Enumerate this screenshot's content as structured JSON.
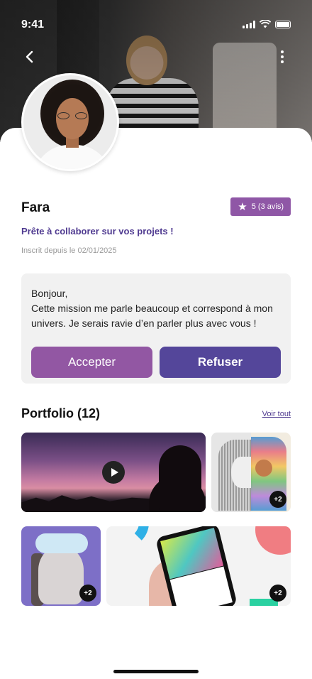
{
  "status_bar": {
    "time": "9:41"
  },
  "header": {
    "back_icon": "chevron-left-icon",
    "menu_icon": "more-vertical-icon"
  },
  "profile": {
    "name": "Fara",
    "rating": "5 (3 avis)",
    "tagline": "Prête à collaborer sur vos projets !",
    "joined": "Inscrit depuis le 02/01/2025"
  },
  "message": {
    "line1": "Bonjour,",
    "line2": "Cette mission me parle beaucoup et correspond à mon univers. Je serais ravie d’en parler plus avec vous !",
    "accept_label": "Accepter",
    "refuse_label": "Refuser"
  },
  "portfolio": {
    "title": "Portfolio (12)",
    "see_all": "Voir tout",
    "items": [
      {
        "kind": "video"
      },
      {
        "kind": "image",
        "more": "+2"
      },
      {
        "kind": "image",
        "more": "+2"
      },
      {
        "kind": "image",
        "more": "+2"
      }
    ]
  },
  "colors": {
    "accept": "#9257a3",
    "refuse": "#54469a",
    "rating_badge": "#8f57a6",
    "tagline": "#4f3a90"
  }
}
